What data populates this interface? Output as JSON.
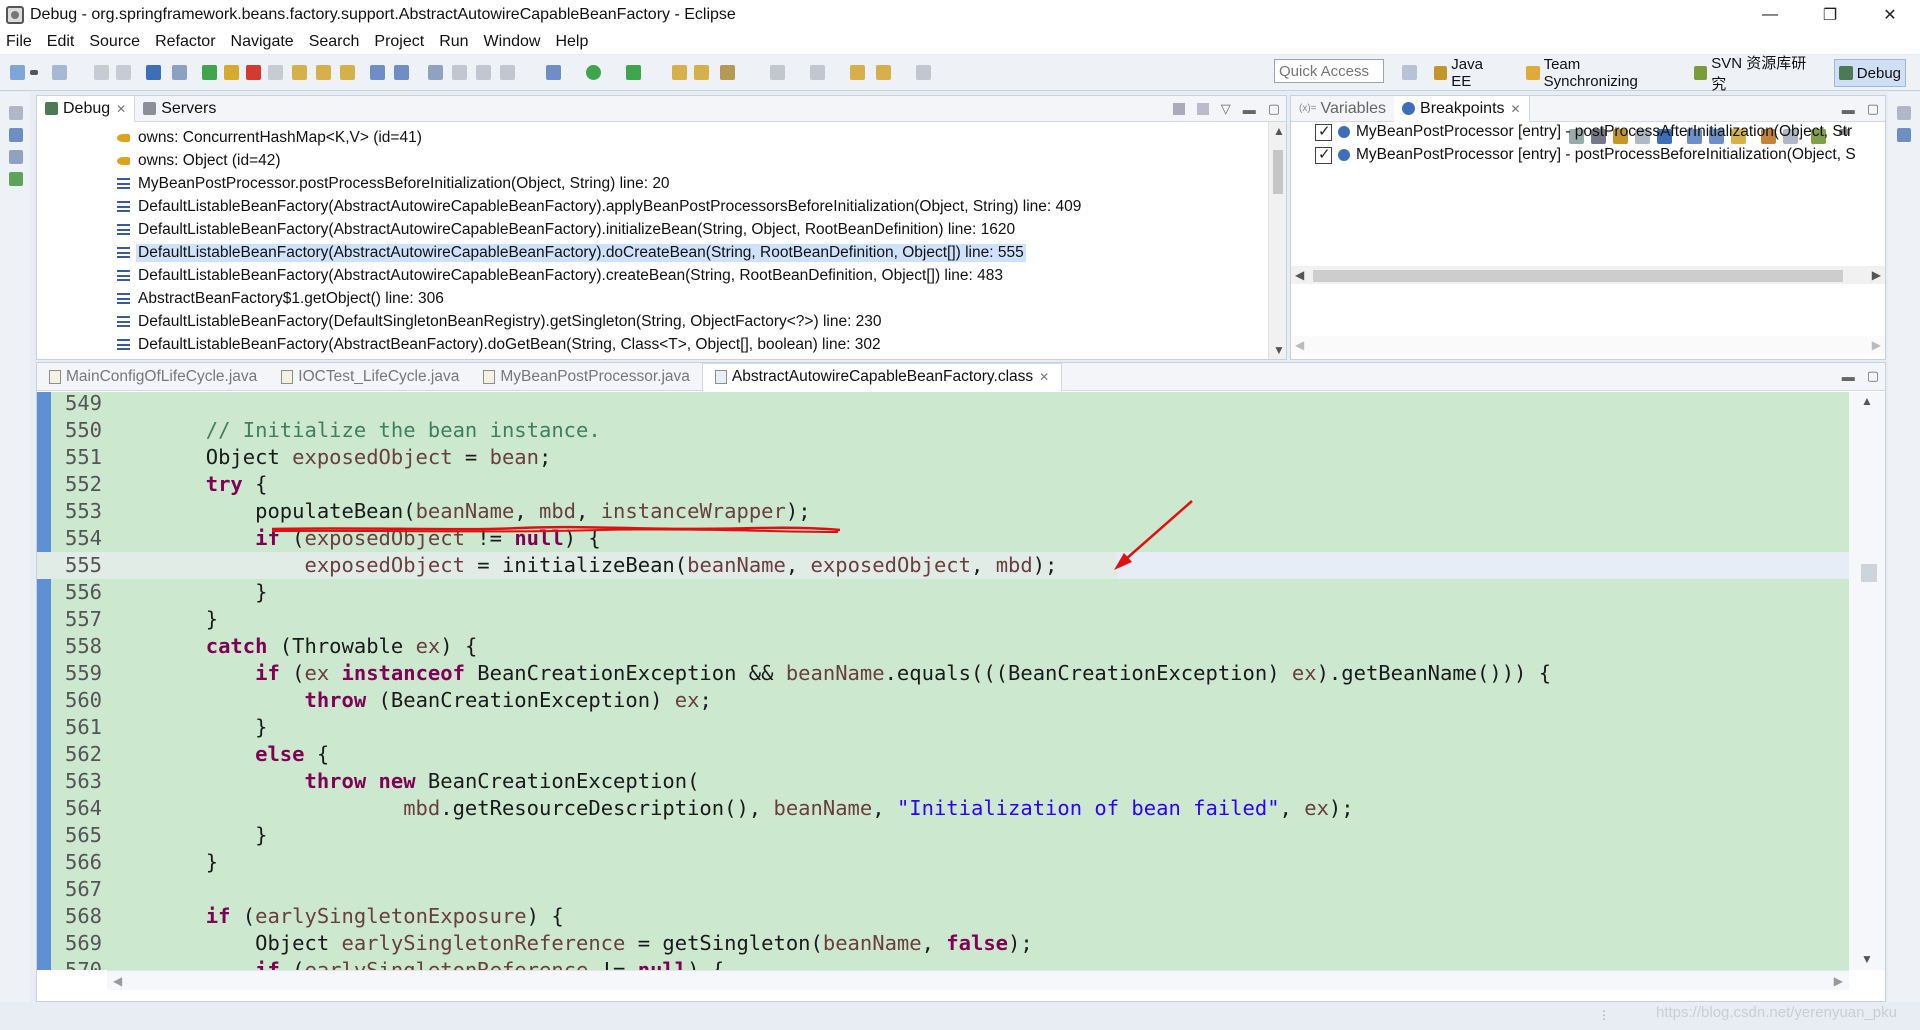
{
  "window": {
    "title": "Debug - org.springframework.beans.factory.support.AbstractAutowireCapableBeanFactory - Eclipse",
    "controls": [
      "—",
      "❐",
      "✕"
    ]
  },
  "menu": [
    "File",
    "Edit",
    "Source",
    "Refactor",
    "Navigate",
    "Search",
    "Project",
    "Run",
    "Window",
    "Help"
  ],
  "toolbar": {
    "quick_access_placeholder": "Quick Access",
    "perspectives": [
      {
        "label": "Java EE",
        "icon": "java-ee-perspective-icon",
        "color": "#c4952a"
      },
      {
        "label": "Team Synchronizing",
        "icon": "team-sync-perspective-icon",
        "color": "#e0a93a"
      },
      {
        "label": "SVN 资源库研究",
        "icon": "svn-perspective-icon",
        "color": "#7a9c3c"
      },
      {
        "label": "Debug",
        "icon": "debug-perspective-icon",
        "color": "#4b7a55"
      }
    ]
  },
  "debug_view": {
    "tabs": [
      {
        "label": "Debug",
        "close": "✕"
      },
      {
        "label": "Servers"
      }
    ],
    "rows": [
      {
        "icon": "key",
        "text": "owns: ConcurrentHashMap<K,V>  (id=41)"
      },
      {
        "icon": "key",
        "text": "owns: Object  (id=42)"
      },
      {
        "icon": "frame",
        "text": "MyBeanPostProcessor.postProcessBeforeInitialization(Object, String) line: 20"
      },
      {
        "icon": "frame",
        "text": "DefaultListableBeanFactory(AbstractAutowireCapableBeanFactory).applyBeanPostProcessorsBeforeInitialization(Object, String) line: 409"
      },
      {
        "icon": "frame",
        "text": "DefaultListableBeanFactory(AbstractAutowireCapableBeanFactory).initializeBean(String, Object, RootBeanDefinition) line: 1620"
      },
      {
        "icon": "frame",
        "text": "DefaultListableBeanFactory(AbstractAutowireCapableBeanFactory).doCreateBean(String, RootBeanDefinition, Object[]) line: 555",
        "selected": true
      },
      {
        "icon": "frame",
        "text": "DefaultListableBeanFactory(AbstractAutowireCapableBeanFactory).createBean(String, RootBeanDefinition, Object[]) line: 483"
      },
      {
        "icon": "frame",
        "text": "AbstractBeanFactory$1.getObject() line: 306"
      },
      {
        "icon": "frame",
        "text": "DefaultListableBeanFactory(DefaultSingletonBeanRegistry).getSingleton(String, ObjectFactory<?>) line: 230"
      },
      {
        "icon": "frame",
        "text": "DefaultListableBeanFactory(AbstractBeanFactory).doGetBean(String, Class<T>, Object[], boolean) line: 302"
      }
    ]
  },
  "breakpoints_view": {
    "tabs": [
      {
        "label": "Variables",
        "prefix": "(x)="
      },
      {
        "label": "Breakpoints",
        "close": "✕"
      }
    ],
    "items": [
      {
        "text": "MyBeanPostProcessor [entry] - postProcessAfterInitialization(Object, Str",
        "checked": true
      },
      {
        "text": "MyBeanPostProcessor [entry] - postProcessBeforeInitialization(Object, S",
        "checked": true
      }
    ]
  },
  "editor": {
    "tabs": [
      {
        "label": "MainConfigOfLifeCycle.java"
      },
      {
        "label": "IOCTest_LifeCycle.java"
      },
      {
        "label": "MyBeanPostProcessor.java"
      },
      {
        "label": "AbstractAutowireCapableBeanFactory.class",
        "active": true,
        "close": "✕"
      }
    ],
    "current_line": "555",
    "lines": [
      {
        "n": "549",
        "html": ""
      },
      {
        "n": "550",
        "html": "        <span class='cm'>// Initialize the bean instance.</span>"
      },
      {
        "n": "551",
        "html": "        Object <span class='vr'>exposedObject</span> = <span class='vr'>bean</span>;"
      },
      {
        "n": "552",
        "html": "        <span class='kw'>try</span> {"
      },
      {
        "n": "553",
        "html": "            populateBean(<span class='vr'>beanName</span>, <span class='vr'>mbd</span>, <span class='vr'>instanceWrapper</span>);"
      },
      {
        "n": "554",
        "html": "            <span class='kw'>if</span> (<span class='vr'>exposedObject</span> != <span class='kw'>null</span>) {"
      },
      {
        "n": "555",
        "html": "                <span class='vr'>exposedObject</span> = initializeBean(<span class='vr'>beanName</span>, <span class='vr'>exposedObject</span>, <span class='vr'>mbd</span>);"
      },
      {
        "n": "556",
        "html": "            }"
      },
      {
        "n": "557",
        "html": "        }"
      },
      {
        "n": "558",
        "html": "        <span class='kw'>catch</span> (Throwable <span class='vr'>ex</span>) {"
      },
      {
        "n": "559",
        "html": "            <span class='kw'>if</span> (<span class='vr'>ex</span> <span class='kw'>instanceof</span> BeanCreationException &amp;&amp; <span class='vr'>beanName</span>.equals(((BeanCreationException) <span class='vr'>ex</span>).getBeanName())) {"
      },
      {
        "n": "560",
        "html": "                <span class='kw'>throw</span> (BeanCreationException) <span class='vr'>ex</span>;"
      },
      {
        "n": "561",
        "html": "            }"
      },
      {
        "n": "562",
        "html": "            <span class='kw'>else</span> {"
      },
      {
        "n": "563",
        "html": "                <span class='kw'>throw</span> <span class='kw'>new</span> BeanCreationException("
      },
      {
        "n": "564",
        "html": "                        <span class='vr'>mbd</span>.getResourceDescription(), <span class='vr'>beanName</span>, <span class='st'>\"Initialization of bean failed\"</span>, <span class='vr'>ex</span>);"
      },
      {
        "n": "565",
        "html": "            }"
      },
      {
        "n": "566",
        "html": "        }"
      },
      {
        "n": "567",
        "html": ""
      },
      {
        "n": "568",
        "html": "        <span class='kw'>if</span> (<span class='vr'>earlySingletonExposure</span>) {"
      },
      {
        "n": "569",
        "html": "            Object <span class='vr'>earlySingletonReference</span> = getSingleton(<span class='vr'>beanName</span>, <span class='kw'>false</span>);"
      },
      {
        "n": "570",
        "html": "            <span class='kw'>if</span> (<span class='vr'>earlySingletonReference</span> != <span class='kw'>null</span>) {"
      }
    ]
  },
  "annotations": {
    "underline_color": "#e01010",
    "arrow_color": "#e01010"
  },
  "watermark": "https://blog.csdn.net/yerenyuan_pku"
}
